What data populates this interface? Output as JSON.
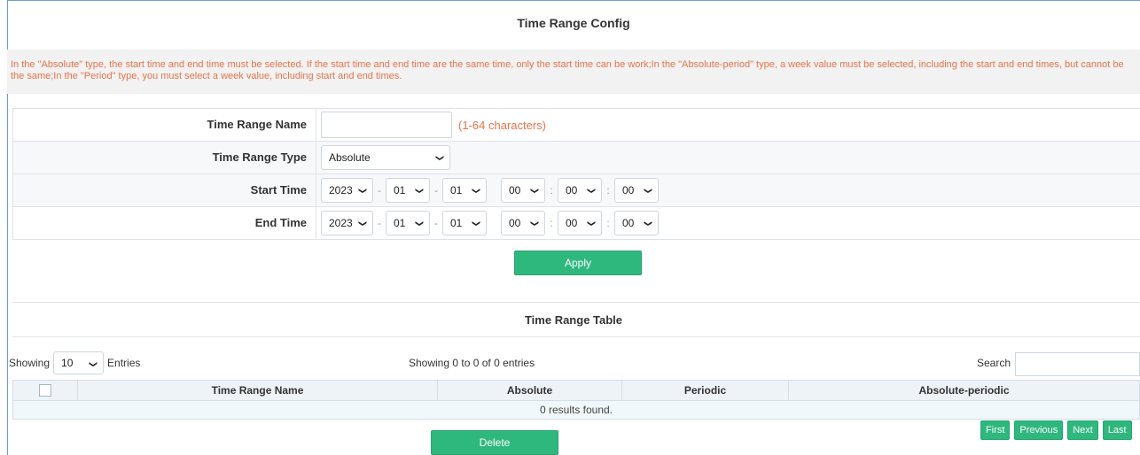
{
  "config": {
    "title": "Time Range Config",
    "notice": "In the \"Absolute\" type, the start time and end time must be selected. If the start time and end time are the same time, only the start time can be work;In the \"Absolute-period\" type, a week value must be selected, including the start and end times, but cannot be the same;In the \"Period\" type, you must select a week value, including start and end times.",
    "name_label": "Time Range Name",
    "name_value": "",
    "name_hint": "(1-64 characters)",
    "type_label": "Time Range Type",
    "type_value": "Absolute",
    "start_label": "Start Time",
    "start": {
      "year": "2023",
      "month": "01",
      "day": "01",
      "hour": "00",
      "minute": "00",
      "second": "00"
    },
    "end_label": "End Time",
    "end": {
      "year": "2023",
      "month": "01",
      "day": "01",
      "hour": "00",
      "minute": "00",
      "second": "00"
    },
    "date_sep": "-",
    "time_sep": ":",
    "apply_label": "Apply"
  },
  "table": {
    "title": "Time Range Table",
    "showing_label": "Showing",
    "page_size": "10",
    "entries_label": "Entries",
    "info": "Showing 0 to 0 of 0 entries",
    "search_label": "Search",
    "search_value": "",
    "columns": [
      "Time Range Name",
      "Absolute",
      "Periodic",
      "Absolute-periodic"
    ],
    "empty_text": "0 results found.",
    "delete_label": "Delete",
    "pager": {
      "first": "First",
      "previous": "Previous",
      "next": "Next",
      "last": "Last"
    }
  },
  "colors": {
    "accent": "#2fb87e",
    "warning_text": "#e8734a",
    "frame_border": "#6a9fd0"
  },
  "icons": {
    "select_arrow": "chevron-down-icon"
  }
}
